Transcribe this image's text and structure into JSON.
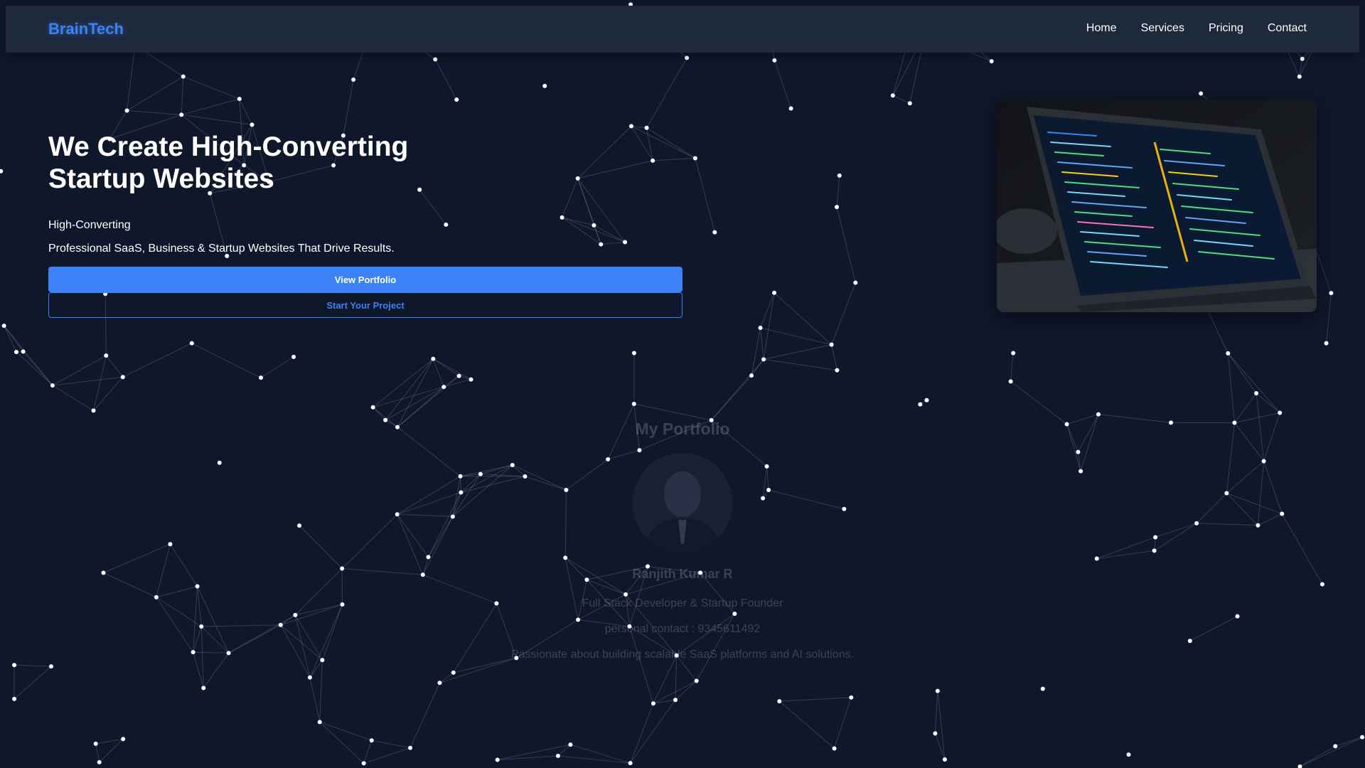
{
  "nav": {
    "brand": "BrainTech",
    "links": [
      "Home",
      "Services",
      "Pricing",
      "Contact"
    ]
  },
  "hero": {
    "title": "We Create High-Converting Startup Websites",
    "tagline": "High-Converting",
    "description": "Professional SaaS, Business & Startup Websites That Drive Results.",
    "primary_button": "View Portfolio",
    "secondary_button": "Start Your Project"
  },
  "portfolio": {
    "section_title": "My Portfolio",
    "name": "Ranjith Kumar R",
    "role": "Full Stack Developer & Startup Founder",
    "contact": "personal contact : 9345611492",
    "bio": "Passionate about building scalable SaaS platforms and AI solutions."
  },
  "colors": {
    "background": "#0f172a",
    "navbar": "#1e293b",
    "accent": "#3b82f6",
    "text": "#ffffff"
  },
  "icons": {
    "background": "particle-network",
    "hero_image": "laptop-code-image",
    "avatar": "profile-photo"
  }
}
